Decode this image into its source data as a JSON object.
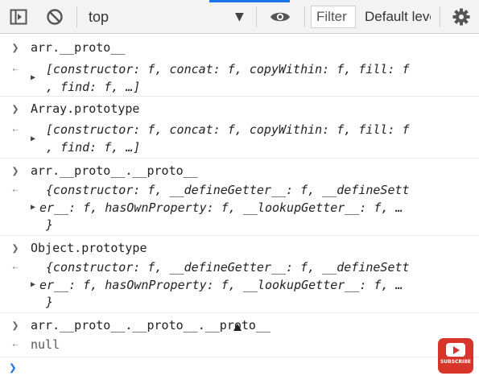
{
  "toolbar": {
    "context": "top",
    "filter_placeholder": "Filter",
    "levels": "Default levels"
  },
  "entries": [
    {
      "input": "arr.__proto__",
      "output_1": "[constructor: f, concat: f, copyWithin: f, fill: f",
      "output_2": ", find: f, …]",
      "output_3": ""
    },
    {
      "input": "Array.prototype",
      "output_1": "[constructor: f, concat: f, copyWithin: f, fill: f",
      "output_2": ", find: f, …]",
      "output_3": ""
    },
    {
      "input": "arr.__proto__.__proto__",
      "output_1": "{constructor: f, __defineGetter__: f, __defineSett",
      "output_2": "er__: f, hasOwnProperty: f, __lookupGetter__: f, …",
      "output_3": "}"
    },
    {
      "input": "Object.prototype",
      "output_1": "{constructor: f, __defineGetter__: f, __defineSett",
      "output_2": "er__: f, hasOwnProperty: f, __lookupGetter__: f, …",
      "output_3": "}"
    },
    {
      "input": "arr.__proto__.__proto__.__proto__",
      "output_1": "null"
    }
  ],
  "badge": {
    "label": "SUBSCRIBE",
    "color": "#d8352a"
  },
  "icons": [
    "panel-toggle-icon",
    "clear-console-icon",
    "eye-icon",
    "gear-icon",
    "chevron-right-icon",
    "return-arrow-icon",
    "disclosure-triangle-icon",
    "youtube-play-icon"
  ]
}
